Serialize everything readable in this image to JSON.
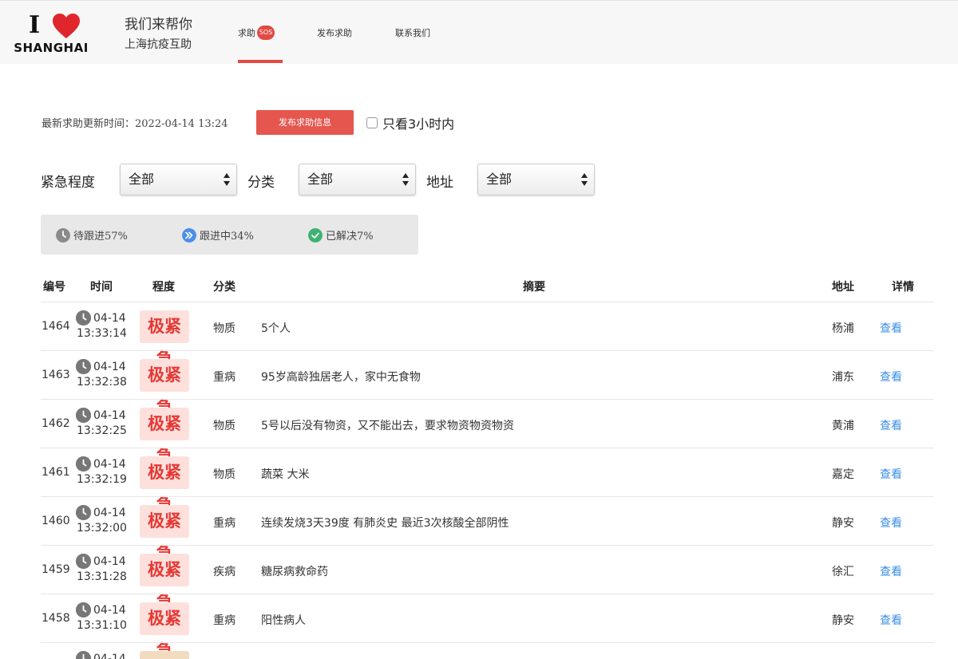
{
  "logo": {
    "i": "I",
    "word": "SHANGHAI"
  },
  "brand": {
    "line1": "我们来帮你",
    "line2": "上海抗疫互助"
  },
  "nav": {
    "help": "求助",
    "sos": "SOS",
    "publish": "发布求助",
    "contact": "联系我们"
  },
  "toolbar": {
    "update_text": "最新求助更新时间：2022-04-14 13:24",
    "publish_button": "发布求助信息",
    "only_3h": "只看3小时内"
  },
  "filters": {
    "urgency_label": "紧急程度",
    "urgency_value": "全部",
    "category_label": "分类",
    "category_value": "全部",
    "address_label": "地址",
    "address_value": "全部"
  },
  "stats": {
    "pending": "待跟进57%",
    "following": "跟进中34%",
    "resolved": "已解决7%"
  },
  "colors": {
    "accent": "#e24a43",
    "pending": "#8a8a8a",
    "following": "#4a8fe7",
    "resolved": "#3cb371",
    "link": "#3a8ee6"
  },
  "table": {
    "headers": [
      "编号",
      "时间",
      "程度",
      "分类",
      "摘要",
      "地址",
      "详情"
    ],
    "rows": [
      {
        "id": "1464",
        "date": "04-14",
        "time": "13:33:14",
        "level": "极紧急",
        "category": "物质",
        "summary": "5个人",
        "address": "杨浦",
        "view": "查看"
      },
      {
        "id": "1463",
        "date": "04-14",
        "time": "13:32:38",
        "level": "极紧急",
        "category": "重病",
        "summary": "95岁高龄独居老人，家中无食物",
        "address": "浦东",
        "view": "查看"
      },
      {
        "id": "1462",
        "date": "04-14",
        "time": "13:32:25",
        "level": "极紧急",
        "category": "物质",
        "summary": "5号以后没有物资，又不能出去，要求物资物资物资",
        "address": "黄浦",
        "view": "查看"
      },
      {
        "id": "1461",
        "date": "04-14",
        "time": "13:32:19",
        "level": "极紧急",
        "category": "物质",
        "summary": "蔬菜 大米",
        "address": "嘉定",
        "view": "查看"
      },
      {
        "id": "1460",
        "date": "04-14",
        "time": "13:32:00",
        "level": "极紧急",
        "category": "重病",
        "summary": "连续发烧3天39度 有肺炎史 最近3次核酸全部阴性",
        "address": "静安",
        "view": "查看"
      },
      {
        "id": "1459",
        "date": "04-14",
        "time": "13:31:28",
        "level": "极紧急",
        "category": "疾病",
        "summary": "糖尿病救命药",
        "address": "徐汇",
        "view": "查看"
      },
      {
        "id": "1458",
        "date": "04-14",
        "time": "13:31:10",
        "level": "极紧急",
        "category": "重病",
        "summary": "阳性病人",
        "address": "静安",
        "view": "查看"
      }
    ],
    "partial_row": {
      "date": "04-14"
    }
  }
}
